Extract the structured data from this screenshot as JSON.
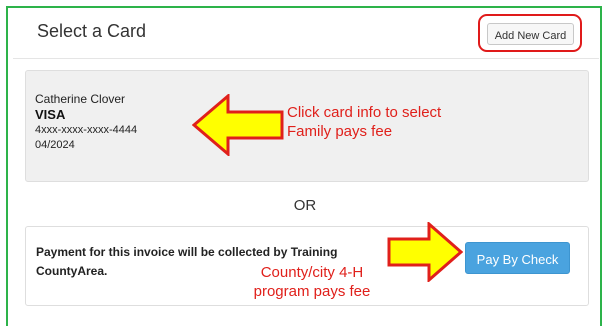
{
  "header": {
    "title": "Select a Card",
    "add_card_label": "Add New Card"
  },
  "card": {
    "holder_name": "Catherine Clover",
    "brand": "VISA",
    "masked_number": "4xxx-xxxx-xxxx-4444",
    "expiration": "04/2024"
  },
  "annotations": {
    "family_note_line1": "Click card info to select",
    "family_note_line2": "Family pays fee",
    "county_note_line1": "County/city 4-H",
    "county_note_line2": "program pays fee",
    "highlight_color": "#e01a1a",
    "arrow_fill": "#ffff00"
  },
  "separator": {
    "or_label": "OR"
  },
  "check_payment": {
    "line1": "Payment for this invoice will be collected by Training",
    "line2": "CountyArea.",
    "button_label": "Pay By Check",
    "button_color": "#4aa3df"
  },
  "frame_color": "#2db34a"
}
